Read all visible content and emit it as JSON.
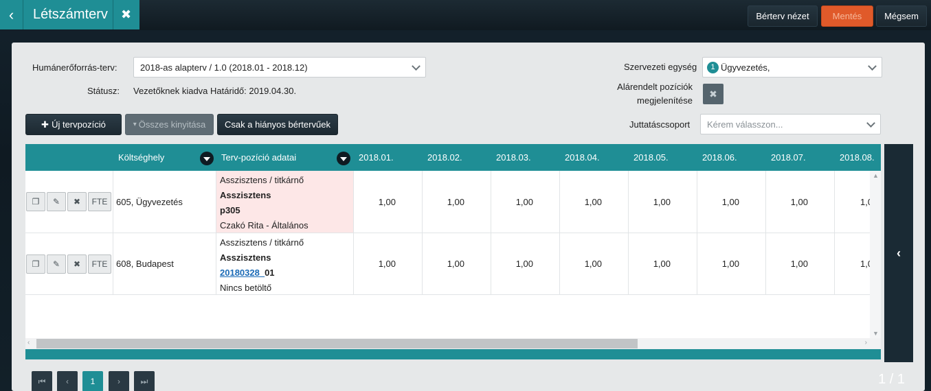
{
  "header": {
    "title": "Létszámterv",
    "buttons": {
      "salary_view": "Bérterv nézet",
      "save": "Mentés",
      "cancel": "Mégsem"
    }
  },
  "form": {
    "hr_plan_label": "Humánerőforrás-terv:",
    "hr_plan_value": "2018-as alapterv / 1.0 (2018.01 - 2018.12)",
    "status_label": "Státusz:",
    "status_value": "Vezetőknek kiadva Határidő: 2019.04.30.",
    "org_unit_label": "Szervezeti egység",
    "org_unit_count": "1",
    "org_unit_value": "Ügyvezetés,",
    "sub_positions_label_1": "Alárendelt pozíciók",
    "sub_positions_label_2": "megjelenítése",
    "benefit_group_label": "Juttatáscsoport",
    "benefit_group_placeholder": "Kérem válasszon..."
  },
  "actions": {
    "new_position": "Új tervpozíció",
    "expand_all": "Összes kinyitása",
    "only_missing": "Csak a hiányos bértervűek"
  },
  "grid": {
    "columns": {
      "cost_center": "Költséghely",
      "position_data": "Terv-pozíció adatai",
      "months": [
        "2018.01.",
        "2018.02.",
        "2018.03.",
        "2018.04.",
        "2018.05.",
        "2018.06.",
        "2018.07.",
        "2018.08."
      ]
    },
    "row_buttons": {
      "fte": "FTE"
    },
    "rows": [
      {
        "cost_center": "605, Ügyvezetés",
        "line1": "Asszisztens / titkárnő",
        "line2": "Asszisztens",
        "line3": "p305",
        "line4": "Czakó Rita - Általános",
        "values": [
          "1,00",
          "1,00",
          "1,00",
          "1,00",
          "1,00",
          "1,00",
          "1,00",
          "1,0"
        ]
      },
      {
        "cost_center": "608, Budapest",
        "line1": "Asszisztens / titkárnő",
        "line2": "Asszisztens",
        "line3_link": "20180328_",
        "line3_rest": "01",
        "line4": "Nincs betöltő",
        "values": [
          "1,00",
          "1,00",
          "1,00",
          "1,00",
          "1,00",
          "1,00",
          "1,00",
          "1,0"
        ]
      }
    ]
  },
  "pagination": {
    "current_page": "1",
    "count": "1 / 1"
  }
}
